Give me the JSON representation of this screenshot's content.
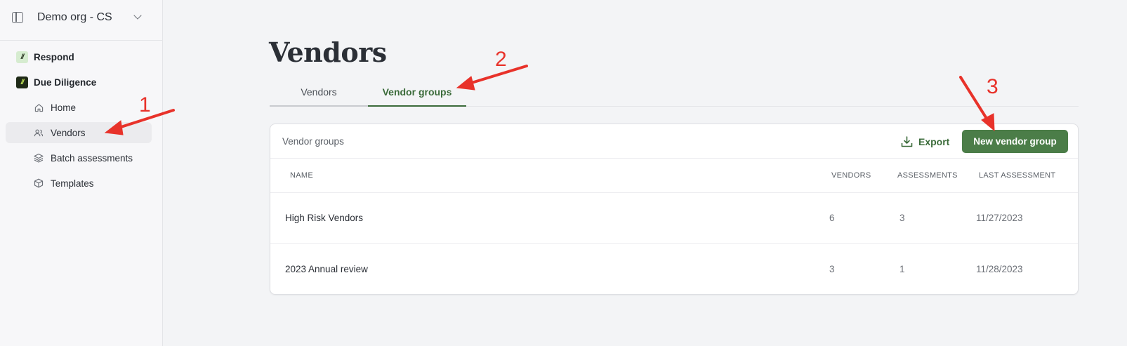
{
  "sidebar": {
    "org_name": "Demo org - CS",
    "sections": [
      {
        "label": "Respond",
        "icon": "respond-logo-icon"
      },
      {
        "label": "Due Diligence",
        "icon": "due-diligence-logo-icon"
      }
    ],
    "items": [
      {
        "label": "Home",
        "icon": "home-icon"
      },
      {
        "label": "Vendors",
        "icon": "users-icon",
        "active": true
      },
      {
        "label": "Batch assessments",
        "icon": "layers-icon"
      },
      {
        "label": "Templates",
        "icon": "box-icon"
      }
    ]
  },
  "page": {
    "title": "Vendors",
    "tabs": [
      {
        "label": "Vendors",
        "active": false
      },
      {
        "label": "Vendor groups",
        "active": true
      }
    ]
  },
  "card": {
    "title": "Vendor groups",
    "export_label": "Export",
    "new_button_label": "New vendor group"
  },
  "table": {
    "columns": [
      "NAME",
      "VENDORS",
      "ASSESSMENTS",
      "LAST ASSESSMENT"
    ],
    "rows": [
      {
        "name": "High Risk Vendors",
        "vendors": "6",
        "assessments": "3",
        "last_assessment": "11/27/2023"
      },
      {
        "name": "2023 Annual review",
        "vendors": "3",
        "assessments": "1",
        "last_assessment": "11/28/2023"
      }
    ]
  },
  "annotations": [
    "1",
    "2",
    "3"
  ],
  "colors": {
    "accent": "#4b7d48",
    "accent_text": "#3b6b3a",
    "annotation": "#e8322a",
    "background": "#f3f4f6",
    "sidebar": "#f7f7f9"
  }
}
